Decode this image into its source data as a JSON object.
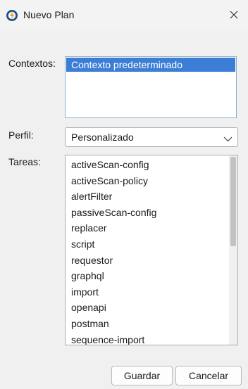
{
  "window": {
    "title": "Nuevo Plan",
    "icon": "zap-logo-icon",
    "close_icon": "close-icon"
  },
  "contexts": {
    "label": "Contextos:",
    "items": [
      "Contexto predeterminado"
    ],
    "selected_index": 0
  },
  "profile": {
    "label": "Perfil:",
    "value": "Personalizado",
    "icon": "chevron-down-icon"
  },
  "tasks": {
    "label": "Tareas:",
    "items": [
      "activeScan-config",
      "activeScan-policy",
      "alertFilter",
      "passiveScan-config",
      "replacer",
      "script",
      "requestor",
      "graphql",
      "import",
      "openapi",
      "postman",
      "sequence-import"
    ]
  },
  "buttons": {
    "save": "Guardar",
    "cancel": "Cancelar"
  },
  "colors": {
    "selection": "#3c7dd6",
    "background": "#f0f0f0",
    "list_background": "#ffffff"
  }
}
